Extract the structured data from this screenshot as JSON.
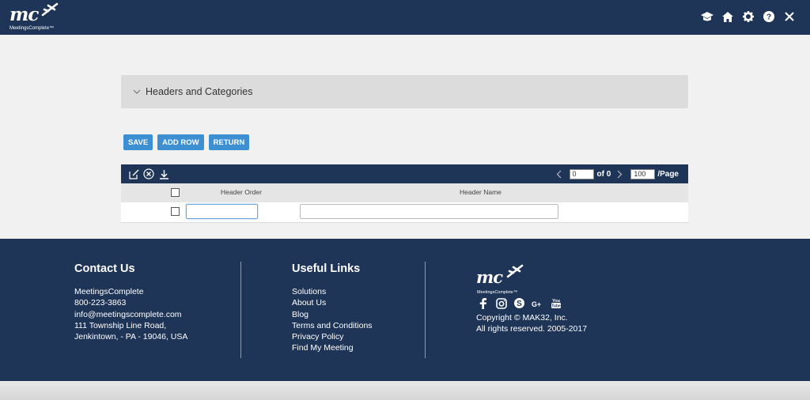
{
  "header": {
    "logo_text": "mc",
    "brand": "MeetingsComplete™",
    "icons": [
      "graduation-cap-icon",
      "home-icon",
      "gear-icon",
      "help-icon",
      "close-icon"
    ]
  },
  "accordion": {
    "label": "Headers and Categories"
  },
  "actions": {
    "save": "SAVE",
    "add_row": "ADD ROW",
    "return": "RETURN"
  },
  "grid": {
    "toolbar_icons": [
      "edit-icon",
      "cancel-icon",
      "download-icon"
    ],
    "pager": {
      "page_value": "0",
      "of_text": "of 0",
      "page_size": "100",
      "per_page": "/Page"
    },
    "columns": [
      "Header Order",
      "Header Name"
    ],
    "rows": [
      {
        "order": "",
        "name": ""
      }
    ]
  },
  "footer": {
    "contact": {
      "title": "Contact Us",
      "lines": [
        "MeetingsComplete",
        "800-223-3863",
        "info@meetingscomplete.com",
        "111 Township Line Road,",
        "Jenkintown, - PA - 19046, USA"
      ]
    },
    "links": {
      "title": "Useful Links",
      "items": [
        "Solutions",
        "About Us",
        "Blog",
        "Terms and Conditions",
        "Privacy Policy",
        "Find My Meeting"
      ]
    },
    "brand": {
      "logo_text": "mc",
      "brand": "MeetingsComplete™",
      "social_icons": [
        "facebook-icon",
        "instagram-icon",
        "skype-icon",
        "google-plus-icon",
        "youtube-icon"
      ]
    },
    "copyright": [
      "Copyright © MAK32, Inc.",
      "All rights reserved. 2005-2017"
    ]
  },
  "colors": {
    "navy": "#1f3557",
    "button_blue": "#3d8fd1"
  }
}
